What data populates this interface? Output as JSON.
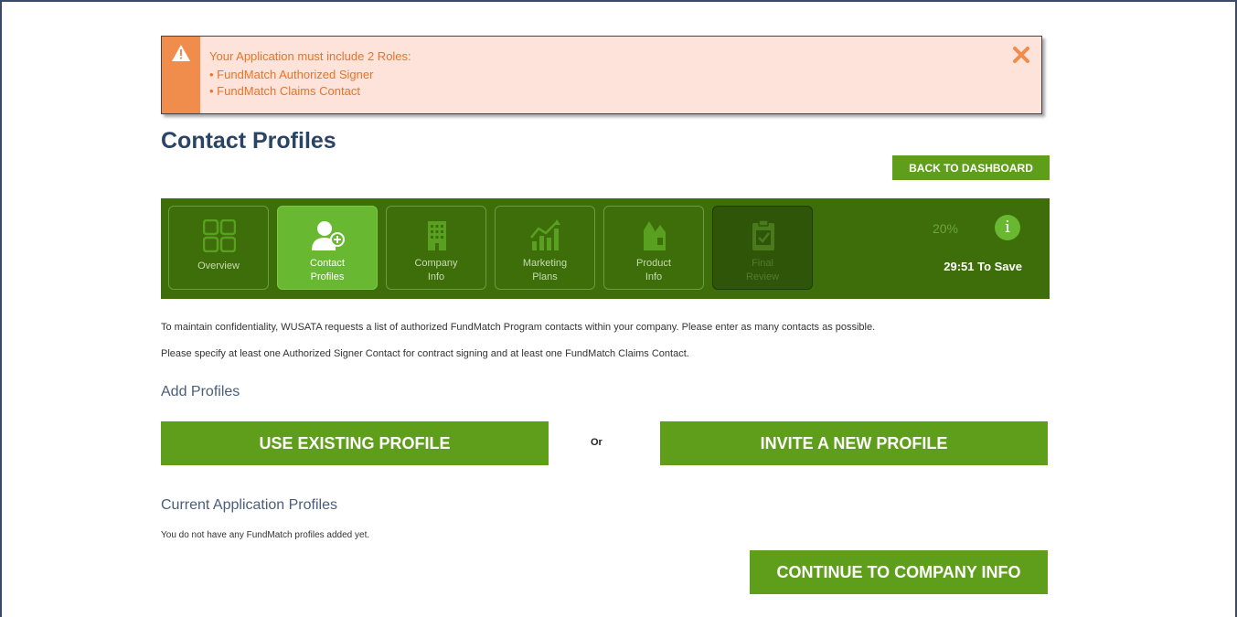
{
  "alert": {
    "title": "Your Application must include 2 Roles:",
    "items": [
      "FundMatch Authorized Signer",
      "FundMatch Claims Contact"
    ],
    "icon": "warning-icon",
    "close_icon": "close-icon",
    "colors": {
      "background": "#fde3d9",
      "accent": "#f08c4c",
      "text": "#e8732a"
    }
  },
  "page": {
    "title": "Contact Profiles",
    "back_label": "BACK TO DASHBOARD"
  },
  "nav": {
    "steps": [
      {
        "label_line1": "Overview",
        "label_line2": "",
        "icon": "grid-icon",
        "state": "normal"
      },
      {
        "label_line1": "Contact",
        "label_line2": "Profiles",
        "icon": "add-contact-icon",
        "state": "active"
      },
      {
        "label_line1": "Company",
        "label_line2": "Info",
        "icon": "building-icon",
        "state": "normal"
      },
      {
        "label_line1": "Marketing",
        "label_line2": "Plans",
        "icon": "chart-growth-icon",
        "state": "normal"
      },
      {
        "label_line1": "Product",
        "label_line2": "Info",
        "icon": "product-icon",
        "state": "normal"
      },
      {
        "label_line1": "Final",
        "label_line2": "Review",
        "icon": "clipboard-check-icon",
        "state": "disabled"
      }
    ],
    "progress": "20%",
    "progress_value": 20,
    "timer": "29:51 To Save",
    "info_label": "i",
    "colors": {
      "bar": "#3d6e0a",
      "active": "#68b832"
    }
  },
  "intro": {
    "line1": "To maintain confidentiality, WUSATA requests a list of authorized FundMatch Program contacts within your company. Please enter as many contacts as possible.",
    "line2": "Please specify at least one Authorized Signer Contact for contract signing and at least one FundMatch Claims Contact."
  },
  "add_profiles": {
    "heading": "Add Profiles",
    "use_existing_label": "USE EXISTING PROFILE",
    "or_label": "Or",
    "invite_label": "INVITE A NEW PROFILE"
  },
  "current_profiles": {
    "heading": "Current Application Profiles",
    "empty_text": "You do not have any FundMatch profiles added yet."
  },
  "footer": {
    "continue_label": "CONTINUE TO COMPANY INFO"
  },
  "brand_color": "#5f9e1a"
}
